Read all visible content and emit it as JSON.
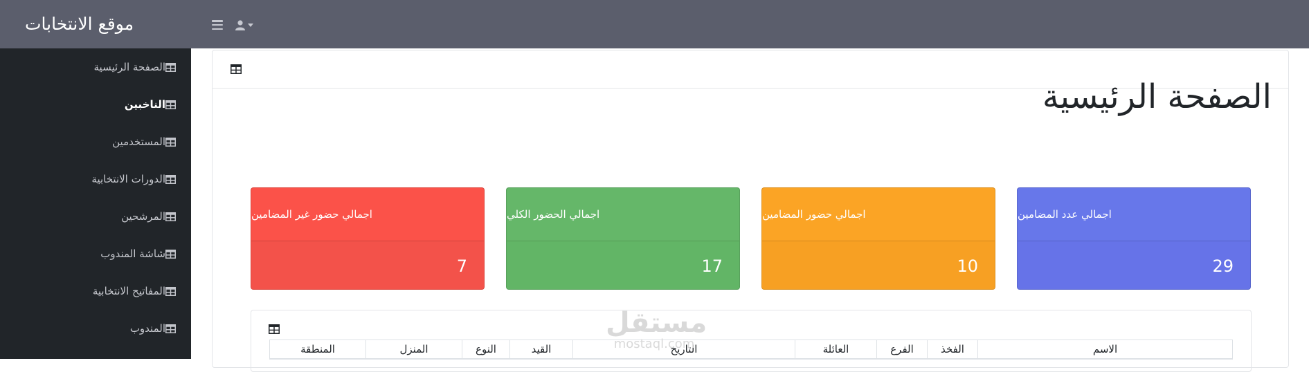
{
  "brand": {
    "title": "موقع الانتخابات"
  },
  "sidebar": {
    "items": [
      {
        "label": "الصفحة الرئيسية",
        "active": false
      },
      {
        "label": "الناخبين",
        "active": true
      },
      {
        "label": "المستخدمين",
        "active": false
      },
      {
        "label": "الدورات الانتخابية",
        "active": false
      },
      {
        "label": "المرشحين",
        "active": false
      },
      {
        "label": "شاشة المندوب",
        "active": false
      },
      {
        "label": "المفاتيح الانتخابية",
        "active": false
      },
      {
        "label": "المندوب",
        "active": false
      }
    ]
  },
  "main": {
    "title": "الصفحة الرئيسية"
  },
  "stats": [
    {
      "label": "اجمالي حضور غير المضامين",
      "value": "7",
      "color": "#fb5249"
    },
    {
      "label": "اجمالي الحضور الكلي",
      "value": "17",
      "color": "#65b769"
    },
    {
      "label": "اجمالي حضور المضامين",
      "value": "10",
      "color": "#fba425"
    },
    {
      "label": "اجمالي عدد المضامين",
      "value": "29",
      "color": "#6777ea"
    }
  ],
  "table": {
    "headers": [
      "المنطقة",
      "المنزل",
      "النوع",
      "القيد",
      "التاريخ",
      "العائلة",
      "الفرع",
      "الفخذ",
      "الاسم"
    ]
  },
  "watermark": {
    "ar": "مستقل",
    "en": "mostaql.com"
  },
  "icons": {
    "table": "table-icon",
    "user": "user-icon",
    "menu": "hamburger-icon"
  }
}
